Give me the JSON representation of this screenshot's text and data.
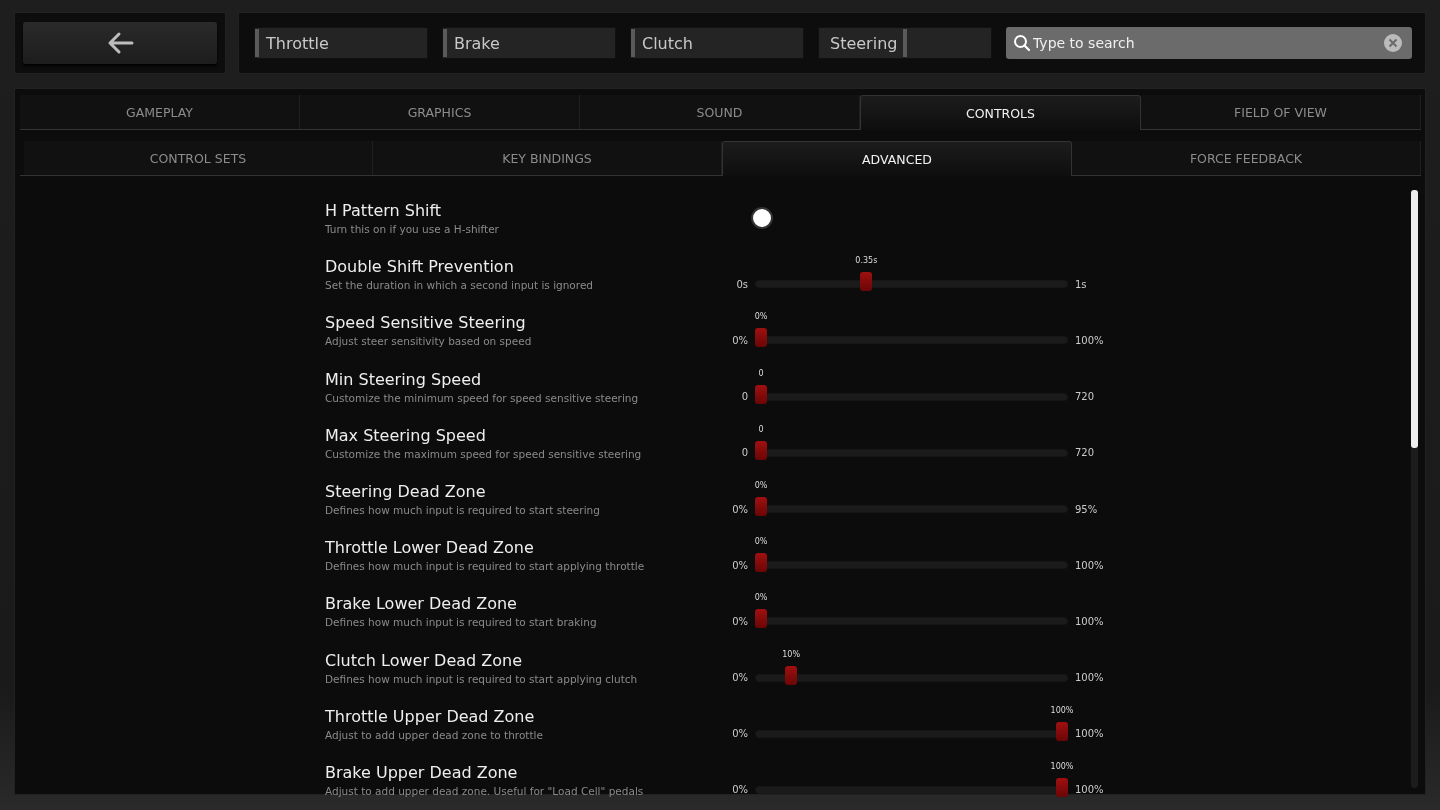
{
  "pedals": [
    {
      "label": "Throttle",
      "level": 0
    },
    {
      "label": "Brake",
      "level": 0
    },
    {
      "label": "Clutch",
      "level": 0
    },
    {
      "label": "Steering",
      "level": 0.5
    }
  ],
  "search": {
    "placeholder": "Type to search"
  },
  "tabs": [
    {
      "label": "GAMEPLAY",
      "selected": false
    },
    {
      "label": "GRAPHICS",
      "selected": false
    },
    {
      "label": "SOUND",
      "selected": false
    },
    {
      "label": "CONTROLS",
      "selected": true
    },
    {
      "label": "FIELD OF VIEW",
      "selected": false
    }
  ],
  "subtabs": [
    {
      "label": "CONTROL SETS",
      "selected": false
    },
    {
      "label": "KEY BINDINGS",
      "selected": false
    },
    {
      "label": "ADVANCED",
      "selected": true
    },
    {
      "label": "FORCE FEEDBACK",
      "selected": false
    }
  ],
  "settings": [
    {
      "kind": "toggle",
      "title": "H Pattern Shift",
      "description": "Turn this on if you use a H-shifter",
      "on": true
    },
    {
      "kind": "slider",
      "title": "Double Shift Prevention",
      "description": "Set the duration in which a second input is ignored",
      "min": "0s",
      "max": "1s",
      "value": "0.35s",
      "level": 0.35
    },
    {
      "kind": "slider",
      "title": "Speed Sensitive Steering",
      "description": "Adjust steer sensitivity based on speed",
      "min": "0%",
      "max": "100%",
      "value": "0%",
      "level": 0
    },
    {
      "kind": "slider",
      "title": "Min Steering Speed",
      "description": "Customize the minimum speed for speed sensitive steering",
      "min": "0",
      "max": "720",
      "value": "0",
      "level": 0
    },
    {
      "kind": "slider",
      "title": "Max Steering Speed",
      "description": "Customize the maximum speed for speed sensitive steering",
      "min": "0",
      "max": "720",
      "value": "0",
      "level": 0
    },
    {
      "kind": "slider",
      "title": "Steering Dead Zone",
      "description": "Defines how much input is required to start steering",
      "min": "0%",
      "max": "95%",
      "value": "0%",
      "level": 0
    },
    {
      "kind": "slider",
      "title": "Throttle Lower Dead Zone",
      "description": "Defines how much input is required to start applying throttle",
      "min": "0%",
      "max": "100%",
      "value": "0%",
      "level": 0
    },
    {
      "kind": "slider",
      "title": "Brake Lower Dead Zone",
      "description": "Defines how much input is required to start braking",
      "min": "0%",
      "max": "100%",
      "value": "0%",
      "level": 0
    },
    {
      "kind": "slider",
      "title": "Clutch Lower Dead Zone",
      "description": "Defines how much input is required to start applying clutch",
      "min": "0%",
      "max": "100%",
      "value": "10%",
      "level": 0.1
    },
    {
      "kind": "slider",
      "title": "Throttle Upper Dead Zone",
      "description": "Adjust to add upper dead zone to throttle",
      "min": "0%",
      "max": "100%",
      "value": "100%",
      "level": 1
    },
    {
      "kind": "slider",
      "title": "Brake Upper Dead Zone",
      "description": "Adjust to add upper dead zone. Useful for \"Load Cell\" pedals",
      "min": "0%",
      "max": "100%",
      "value": "100%",
      "level": 1
    }
  ]
}
